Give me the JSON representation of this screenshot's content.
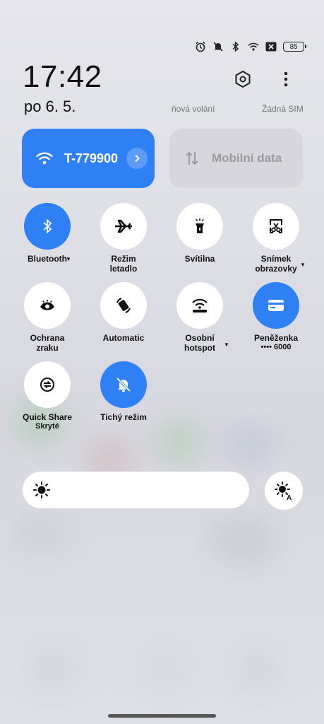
{
  "status": {
    "battery": "85"
  },
  "clock": {
    "time": "17:42",
    "date": "po 6. 5."
  },
  "carriers": {
    "left": "ňová volání",
    "right": "Žádná SIM"
  },
  "wifi_tile": {
    "label": "T-779900"
  },
  "data_tile": {
    "label": "Mobilní data"
  },
  "toggles": {
    "bluetooth": {
      "label": "Bluetooth"
    },
    "airplane": {
      "label1": "Režim",
      "label2": "letadlo"
    },
    "flashlight": {
      "label": "Svítilna"
    },
    "screenshot": {
      "label1": "Snímek",
      "label2": "obrazovky"
    },
    "eye": {
      "label1": "Ochrana",
      "label2": "zraku"
    },
    "rotate": {
      "label": "Automatic"
    },
    "hotspot": {
      "label1": "Osobní",
      "label2": "hotspot"
    },
    "wallet": {
      "label": "Peněženka",
      "sub": "•••• 6000"
    },
    "quickshare": {
      "label": "Quick Share",
      "sub": "Skryté"
    },
    "silent": {
      "label": "Tichý režim"
    }
  },
  "colors": {
    "accent": "#2f7ff5",
    "tile_off": "#ffffff",
    "data_tile_bg": "#d6d6dc"
  },
  "icons": [
    "alarm-icon",
    "mute-icon",
    "bluetooth-icon",
    "wifi-icon",
    "sim-none-icon",
    "battery-icon",
    "settings-hexagon-icon",
    "more-icon",
    "chevron-right-icon",
    "mobile-data-icon",
    "airplane-icon",
    "flashlight-icon",
    "screenshot-scissors-icon",
    "eye-icon",
    "rotate-icon",
    "hotspot-icon",
    "wallet-card-icon",
    "quick-share-icon",
    "bell-off-icon",
    "brightness-icon",
    "auto-brightness-icon"
  ]
}
